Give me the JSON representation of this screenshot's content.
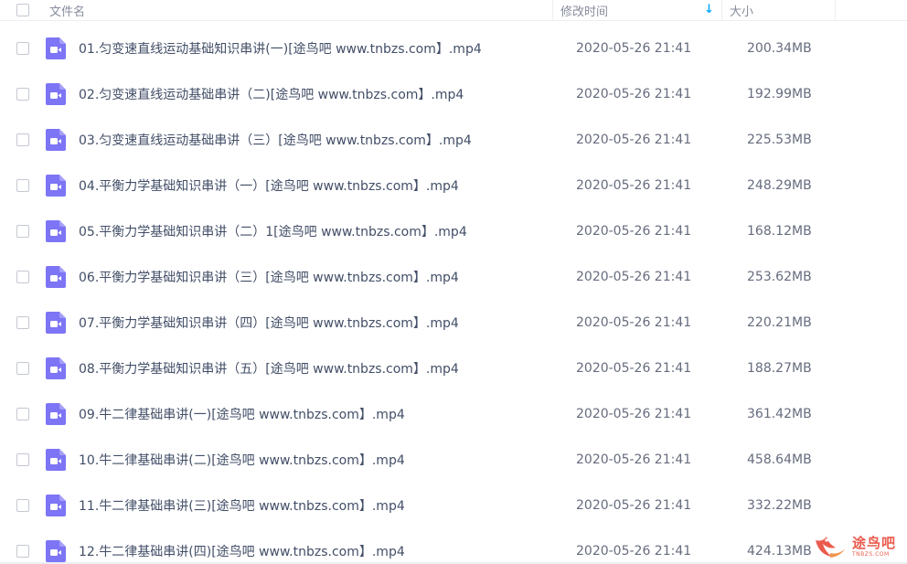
{
  "header": {
    "name_label": "文件名",
    "time_label": "修改时间",
    "sort_arrow": "↓",
    "size_label": "大小"
  },
  "files": [
    {
      "name": "01.匀变速直线运动基础知识串讲(一)[途鸟吧 www.tnbzs.com】.mp4",
      "time": "2020-05-26 21:41",
      "size": "200.34MB"
    },
    {
      "name": "02.匀变速直线运动基础串讲（二)[途鸟吧 www.tnbzs.com】.mp4",
      "time": "2020-05-26 21:41",
      "size": "192.99MB"
    },
    {
      "name": "03.匀变速直线运动基础串讲（三）[途鸟吧 www.tnbzs.com】.mp4",
      "time": "2020-05-26 21:41",
      "size": "225.53MB"
    },
    {
      "name": "04.平衡力学基础知识串讲（一）[途鸟吧 www.tnbzs.com】.mp4",
      "time": "2020-05-26 21:41",
      "size": "248.29MB"
    },
    {
      "name": "05.平衡力学基础知识串讲（二）1[途鸟吧 www.tnbzs.com】.mp4",
      "time": "2020-05-26 21:41",
      "size": "168.12MB"
    },
    {
      "name": "06.平衡力学基础知识串讲（三）[途鸟吧 www.tnbzs.com】.mp4",
      "time": "2020-05-26 21:41",
      "size": "253.62MB"
    },
    {
      "name": "07.平衡力学基础知识串讲（四）[途鸟吧 www.tnbzs.com】.mp4",
      "time": "2020-05-26 21:41",
      "size": "220.21MB"
    },
    {
      "name": "08.平衡力学基础知识串讲（五）[途鸟吧 www.tnbzs.com】.mp4",
      "time": "2020-05-26 21:41",
      "size": "188.27MB"
    },
    {
      "name": "09.牛二律基础串讲(一)[途鸟吧 www.tnbzs.com】.mp4",
      "time": "2020-05-26 21:41",
      "size": "361.42MB"
    },
    {
      "name": "10.牛二律基础串讲(二)[途鸟吧 www.tnbzs.com】.mp4",
      "time": "2020-05-26 21:41",
      "size": "458.64MB"
    },
    {
      "name": "11.牛二律基础串讲(三)[途鸟吧 www.tnbzs.com】.mp4",
      "time": "2020-05-26 21:41",
      "size": "332.22MB"
    },
    {
      "name": "12.牛二律基础串讲(四)[途鸟吧 www.tnbzs.com】.mp4",
      "time": "2020-05-26 21:41",
      "size": "424.13MB"
    }
  ],
  "watermark": {
    "text": "途鸟吧",
    "subtext": "TNBZS.COM"
  },
  "colors": {
    "icon": "#7d75f5",
    "accent": "#06a7ff",
    "watermark": "#e84a3b"
  },
  "icons": {
    "file": "video-file-icon",
    "sort": "sort-down-arrow-icon",
    "logo": "tuniao-bird-logo-icon"
  }
}
